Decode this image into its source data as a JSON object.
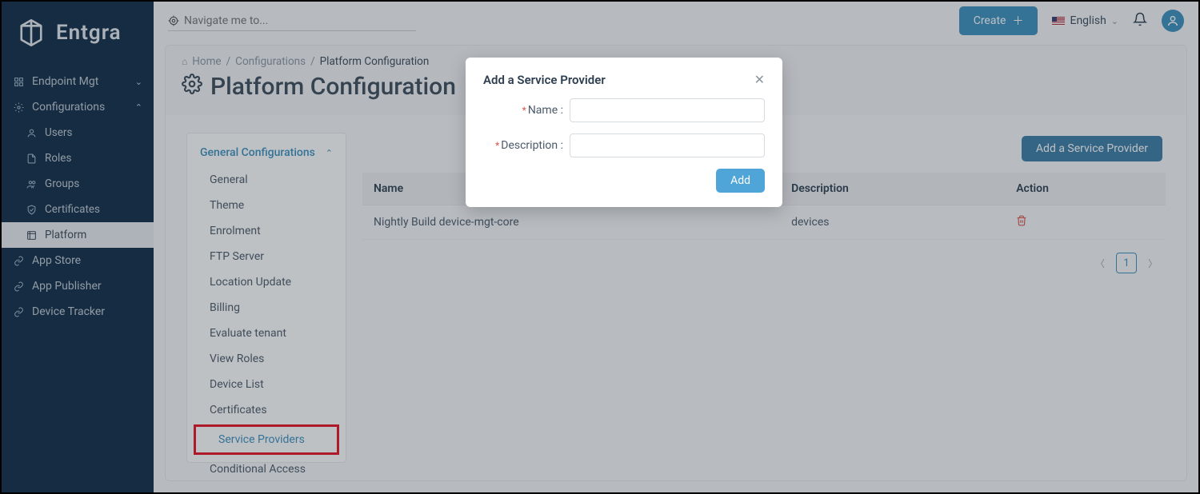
{
  "brand": {
    "name": "Entgra"
  },
  "topbar": {
    "nav_placeholder": "Navigate me to...",
    "create_label": "Create",
    "language_label": "English"
  },
  "sidebar": {
    "items": [
      {
        "label": "Endpoint Mgt",
        "icon": "grid",
        "expandable": true,
        "open": false
      },
      {
        "label": "Configurations",
        "icon": "gear",
        "expandable": true,
        "open": true,
        "children": [
          {
            "label": "Users",
            "icon": "user"
          },
          {
            "label": "Roles",
            "icon": "doc"
          },
          {
            "label": "Groups",
            "icon": "groups"
          },
          {
            "label": "Certificates",
            "icon": "shield"
          },
          {
            "label": "Platform",
            "icon": "platform",
            "active": true
          }
        ]
      },
      {
        "label": "App Store",
        "icon": "link"
      },
      {
        "label": "App Publisher",
        "icon": "link"
      },
      {
        "label": "Device Tracker",
        "icon": "link"
      }
    ]
  },
  "breadcrumb": {
    "home": "Home",
    "mid": "Configurations",
    "current": "Platform Configuration"
  },
  "page": {
    "title": "Platform Configuration"
  },
  "settings_panel": {
    "header": "General Configurations",
    "items": [
      "General",
      "Theme",
      "Enrolment",
      "FTP Server",
      "Location Update",
      "Billing",
      "Evaluate tenant",
      "View Roles",
      "Device List",
      "Certificates",
      "Service Providers",
      "Conditional Access"
    ],
    "active_index": 10
  },
  "table": {
    "add_button": "Add a Service Provider",
    "columns": {
      "name": "Name",
      "description": "Description",
      "action": "Action"
    },
    "rows": [
      {
        "name": "Nightly Build device-mgt-core",
        "description": "devices"
      }
    ],
    "page": "1"
  },
  "modal": {
    "title": "Add a Service Provider",
    "name_label": "Name",
    "description_label": "Description",
    "add_label": "Add"
  }
}
